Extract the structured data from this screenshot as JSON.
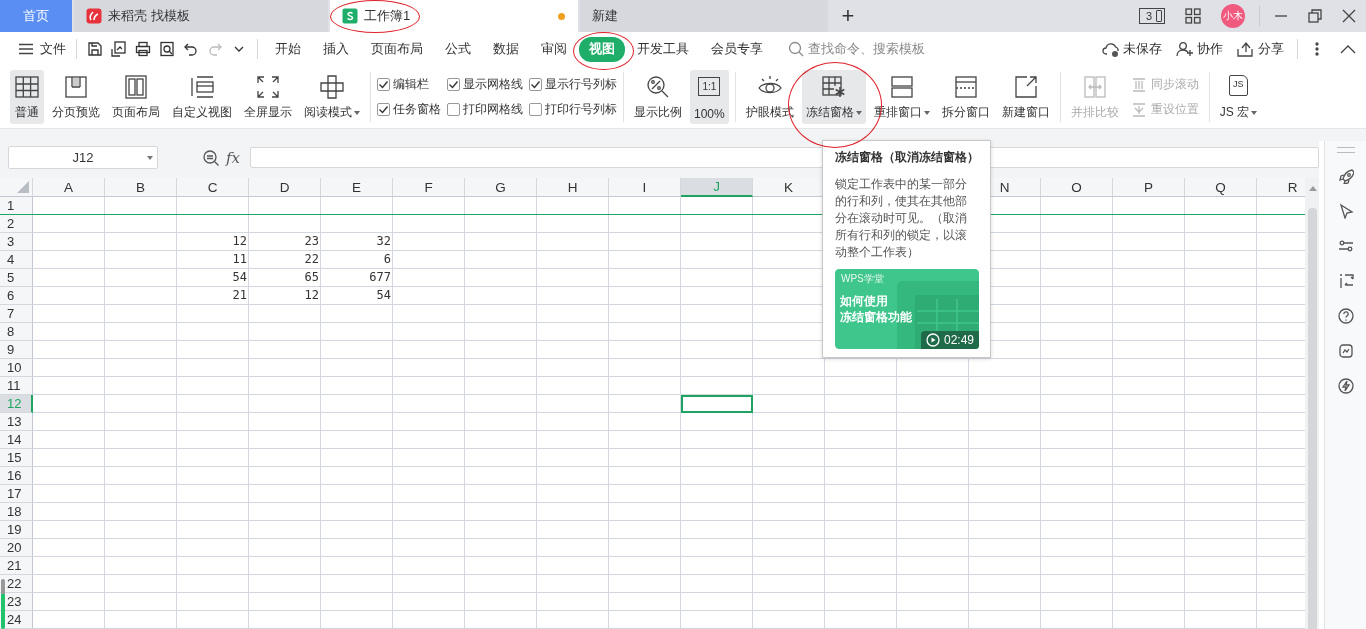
{
  "title_bar": {
    "tabs": [
      {
        "kind": "home",
        "label": "首页",
        "selected": false,
        "modified": false,
        "circled": false
      },
      {
        "kind": "docer",
        "label": "来稻壳 找模板",
        "selected": false,
        "modified": false,
        "circled": false
      },
      {
        "kind": "sheet",
        "label": "工作簿1",
        "selected": true,
        "modified": true,
        "circled": true
      },
      {
        "kind": "plain",
        "label": "新建",
        "selected": false,
        "modified": false,
        "circled": false
      }
    ],
    "new_tab": "+",
    "window_count": "3",
    "avatar": "小木"
  },
  "menu": {
    "file": "文件",
    "tabs": [
      {
        "label": "开始",
        "selected": false,
        "circled": false
      },
      {
        "label": "插入",
        "selected": false,
        "circled": false
      },
      {
        "label": "页面布局",
        "selected": false,
        "circled": false
      },
      {
        "label": "公式",
        "selected": false,
        "circled": false
      },
      {
        "label": "数据",
        "selected": false,
        "circled": false
      },
      {
        "label": "审阅",
        "selected": false,
        "circled": false
      },
      {
        "label": "视图",
        "selected": true,
        "circled": true
      },
      {
        "label": "开发工具",
        "selected": false,
        "circled": false
      },
      {
        "label": "会员专享",
        "selected": false,
        "circled": false
      }
    ],
    "search": {
      "placeholder": "查找命令、搜索模板"
    },
    "actions": [
      "未保存",
      "协作",
      "分享"
    ]
  },
  "ribbon": [
    {
      "kind": "large",
      "label": "普通",
      "selected": true,
      "dropdown": false,
      "circled": false,
      "disabled": false
    },
    {
      "kind": "large",
      "label": "分页预览",
      "selected": false,
      "dropdown": false,
      "circled": false,
      "disabled": false
    },
    {
      "kind": "large",
      "label": "页面布局",
      "selected": false,
      "dropdown": false,
      "circled": false,
      "disabled": false
    },
    {
      "kind": "large",
      "label": "自定义视图",
      "selected": false,
      "dropdown": false,
      "circled": false,
      "disabled": false
    },
    {
      "kind": "large",
      "label": "全屏显示",
      "selected": false,
      "dropdown": false,
      "circled": false,
      "disabled": false
    },
    {
      "kind": "large",
      "label": "阅读模式",
      "selected": false,
      "dropdown": true,
      "circled": false,
      "disabled": false
    },
    {
      "kind": "separator"
    },
    {
      "kind": "checks",
      "items": [
        {
          "label": "编辑栏",
          "checked": true
        },
        {
          "label": "显示网格线",
          "checked": true
        },
        {
          "label": "显示行号列标",
          "checked": true
        },
        {
          "label": "任务窗格",
          "checked": true
        },
        {
          "label": "打印网格线",
          "checked": false
        },
        {
          "label": "打印行号列标",
          "checked": false
        }
      ]
    },
    {
      "kind": "separator"
    },
    {
      "kind": "large",
      "label": "显示比例",
      "selected": false,
      "dropdown": false,
      "circled": false,
      "disabled": false
    },
    {
      "kind": "ratio",
      "icon_text": "1:1",
      "label": "100%",
      "selected": true
    },
    {
      "kind": "separator"
    },
    {
      "kind": "large",
      "label": "护眼模式",
      "selected": false,
      "dropdown": false,
      "circled": false,
      "disabled": false
    },
    {
      "kind": "large",
      "label": "冻结窗格",
      "selected": true,
      "dropdown": true,
      "circled": true,
      "disabled": false
    },
    {
      "kind": "large",
      "label": "重排窗口",
      "selected": false,
      "dropdown": true,
      "circled": false,
      "disabled": false
    },
    {
      "kind": "large",
      "label": "拆分窗口",
      "selected": false,
      "dropdown": false,
      "circled": false,
      "disabled": false
    },
    {
      "kind": "large",
      "label": "新建窗口",
      "selected": false,
      "dropdown": false,
      "circled": false,
      "disabled": false
    },
    {
      "kind": "separator"
    },
    {
      "kind": "large",
      "label": "并排比较",
      "selected": false,
      "dropdown": false,
      "circled": false,
      "disabled": true
    },
    {
      "kind": "smalls",
      "items": [
        {
          "label": "同步滚动",
          "disabled": true
        },
        {
          "label": "重设位置",
          "disabled": true
        }
      ]
    },
    {
      "kind": "separator"
    },
    {
      "kind": "macro",
      "icon_text": "JS",
      "label": "JS 宏",
      "dropdown": true
    }
  ],
  "formula_bar": {
    "name_box": "J12",
    "fx": "fx"
  },
  "sheet": {
    "columns": [
      {
        "kind": "header",
        "label": "A",
        "selected": false
      },
      {
        "kind": "header",
        "label": "B",
        "selected": false
      },
      {
        "kind": "header",
        "label": "C",
        "selected": false
      },
      {
        "kind": "header",
        "label": "D",
        "selected": false
      },
      {
        "kind": "header",
        "label": "E",
        "selected": false
      },
      {
        "kind": "header",
        "label": "F",
        "selected": false
      },
      {
        "kind": "header",
        "label": "G",
        "selected": false
      },
      {
        "kind": "header",
        "label": "H",
        "selected": false
      },
      {
        "kind": "header",
        "label": "I",
        "selected": false
      },
      {
        "kind": "header",
        "label": "J",
        "selected": true
      },
      {
        "kind": "header",
        "label": "K",
        "selected": false
      },
      {
        "kind": "covered"
      },
      {
        "kind": "covered"
      },
      {
        "kind": "header",
        "label": "N",
        "selected": false
      },
      {
        "kind": "header",
        "label": "O",
        "selected": false
      },
      {
        "kind": "header",
        "label": "P",
        "selected": false
      },
      {
        "kind": "header",
        "label": "Q",
        "selected": false
      },
      {
        "kind": "header",
        "label": "R",
        "selected": false
      }
    ],
    "rows": [
      {
        "number": "1",
        "selected": false,
        "frozen": true
      },
      {
        "number": "2",
        "selected": false,
        "frozen": false
      },
      {
        "number": "3",
        "selected": false,
        "frozen": false,
        "cells": [
          null,
          null,
          "12",
          "23",
          "32"
        ]
      },
      {
        "number": "4",
        "selected": false,
        "frozen": false,
        "cells": [
          null,
          null,
          "11",
          "22",
          "6"
        ]
      },
      {
        "number": "5",
        "selected": false,
        "frozen": false,
        "cells": [
          null,
          null,
          "54",
          "65",
          "677"
        ]
      },
      {
        "number": "6",
        "selected": false,
        "frozen": false,
        "cells": [
          null,
          null,
          "21",
          "12",
          "54"
        ]
      },
      {
        "number": "7",
        "selected": false,
        "frozen": false
      },
      {
        "number": "8",
        "selected": false,
        "frozen": false
      },
      {
        "number": "9",
        "selected": false,
        "frozen": false
      },
      {
        "number": "10",
        "selected": false,
        "frozen": false
      },
      {
        "number": "11",
        "selected": false,
        "frozen": false
      },
      {
        "number": "12",
        "selected": true,
        "frozen": false
      },
      {
        "number": "13",
        "selected": false,
        "frozen": false
      },
      {
        "number": "14",
        "selected": false,
        "frozen": false
      },
      {
        "number": "15",
        "selected": false,
        "frozen": false
      },
      {
        "number": "16",
        "selected": false,
        "frozen": false
      },
      {
        "number": "17",
        "selected": false,
        "frozen": false
      },
      {
        "number": "18",
        "selected": false,
        "frozen": false
      },
      {
        "number": "19",
        "selected": false,
        "frozen": false
      },
      {
        "number": "20",
        "selected": false,
        "frozen": false
      },
      {
        "number": "21",
        "selected": false,
        "frozen": false
      },
      {
        "number": "22",
        "selected": false,
        "frozen": false
      },
      {
        "number": "23",
        "selected": false,
        "frozen": false
      },
      {
        "number": "24",
        "selected": false,
        "frozen": false
      }
    ]
  },
  "tooltip": {
    "title": "冻结窗格（取消冻结窗格）",
    "description": "锁定工作表中的某一部分的行和列，使其在其他部分在滚动时可见。（取消所有行和列的锁定，以滚动整个工作表）",
    "video": {
      "brand": "WPS学堂",
      "title_lines": [
        "如何使用",
        "冻结窗格功能"
      ],
      "duration": "02:49"
    }
  }
}
